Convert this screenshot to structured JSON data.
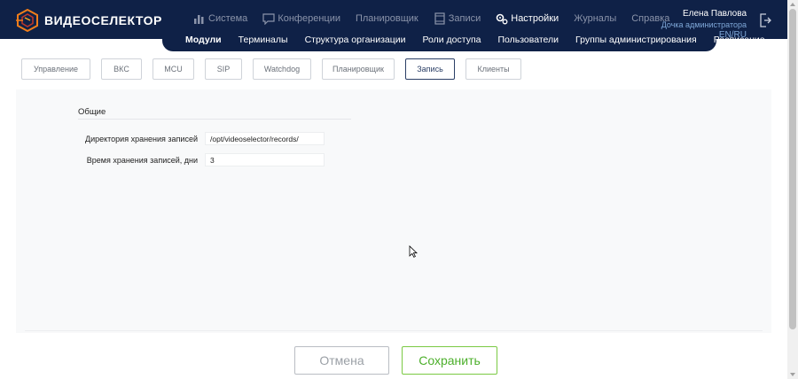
{
  "app": {
    "logo_text": "ВИДЕОСЕЛЕКТОР"
  },
  "top_menu": [
    {
      "label": "Система",
      "icon": "bar-chart-icon",
      "active": false
    },
    {
      "label": "Конференции",
      "icon": "chat-icon",
      "active": false
    },
    {
      "label": "Планировщик",
      "icon": "",
      "active": false
    },
    {
      "label": "Записи",
      "icon": "film-icon",
      "active": false
    },
    {
      "label": "Настройки",
      "icon": "gears-icon",
      "active": true
    },
    {
      "label": "Журналы",
      "icon": "",
      "active": false
    },
    {
      "label": "Справка",
      "icon": "",
      "active": false
    }
  ],
  "user": {
    "name": "Елена Павлова",
    "role": "Дочка администратора",
    "lang": "EN/RU"
  },
  "sub_menu": [
    {
      "label": "Модули",
      "active": true
    },
    {
      "label": "Терминалы",
      "active": false
    },
    {
      "label": "Структура организации",
      "active": false
    },
    {
      "label": "Роли доступа",
      "active": false
    },
    {
      "label": "Пользователи",
      "active": false
    },
    {
      "label": "Группы администрирования",
      "active": false
    },
    {
      "label": "Расписание",
      "active": false
    }
  ],
  "tabs": [
    {
      "label": "Управление",
      "active": false
    },
    {
      "label": "ВКС",
      "active": false
    },
    {
      "label": "MCU",
      "active": false
    },
    {
      "label": "SIP",
      "active": false
    },
    {
      "label": "Watchdog",
      "active": false
    },
    {
      "label": "Планировщик",
      "active": false
    },
    {
      "label": "Запись",
      "active": true
    },
    {
      "label": "Клиенты",
      "active": false
    }
  ],
  "section": {
    "title": "Общие",
    "fields": [
      {
        "label": "Директория хранения записей",
        "value": "/opt/videoselector/records/"
      },
      {
        "label": "Время хранения записей, дни",
        "value": "3"
      }
    ]
  },
  "buttons": {
    "cancel": "Отмена",
    "save": "Сохранить"
  },
  "colors": {
    "header": "#0f2147",
    "save": "#4caf2b",
    "active_tab": "#2b3f66"
  }
}
